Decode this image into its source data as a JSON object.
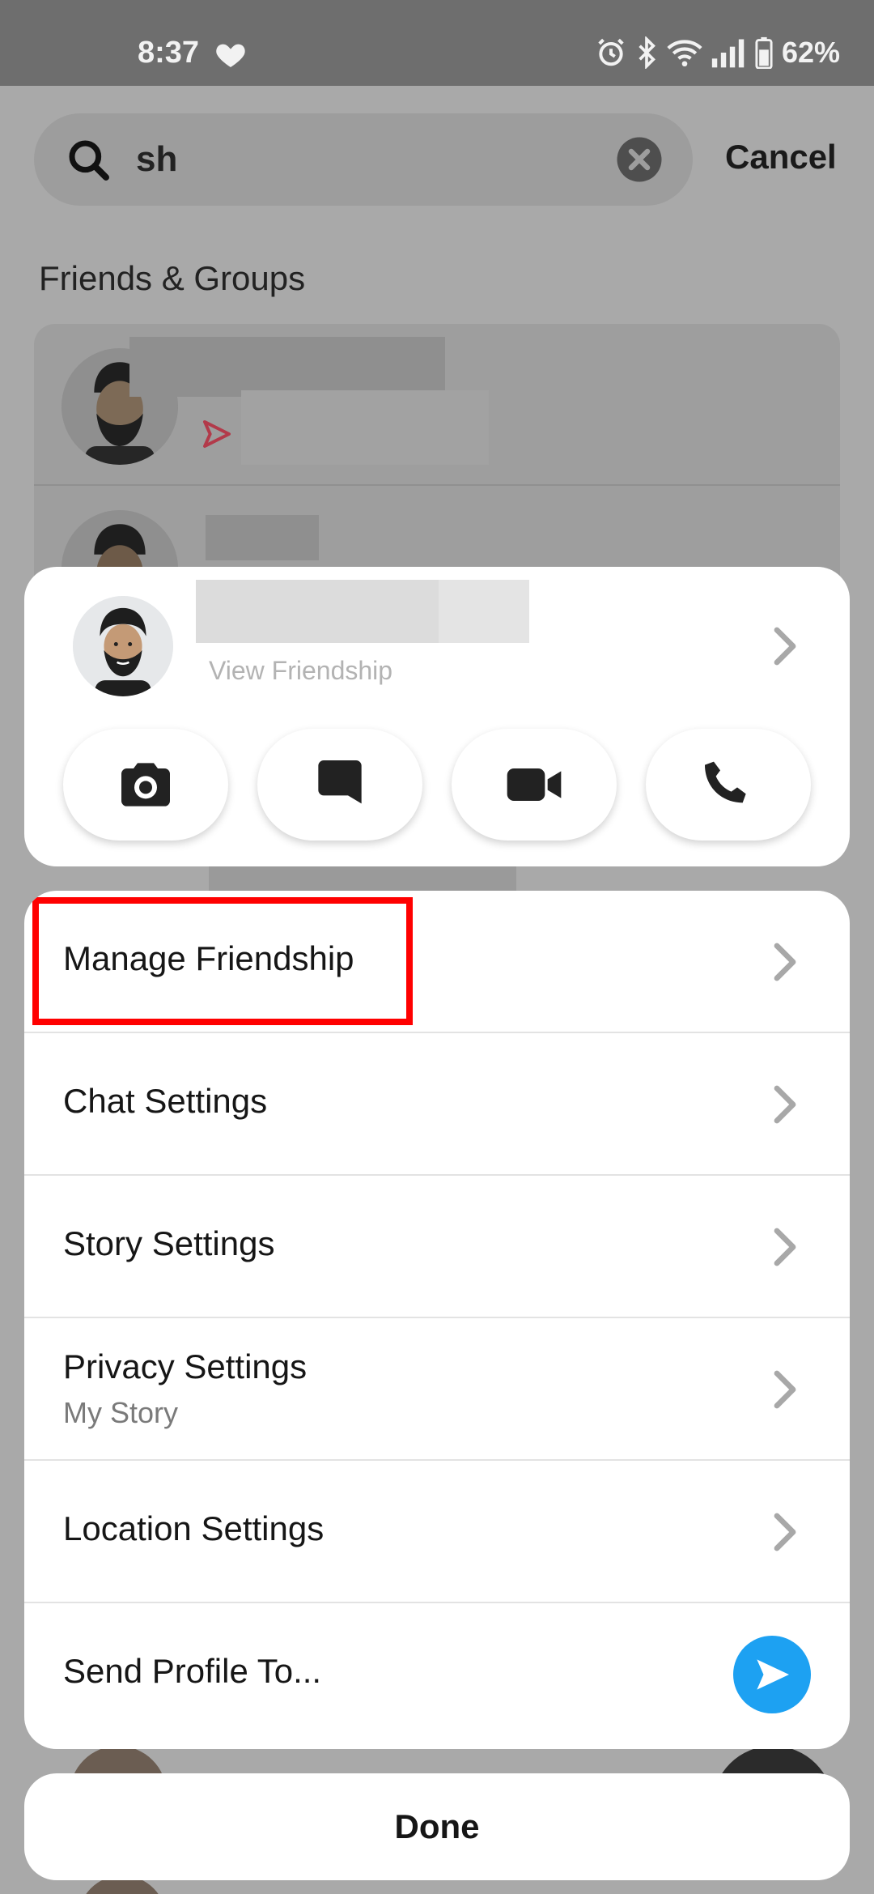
{
  "status_bar": {
    "time": "8:37",
    "battery": "62%",
    "icons": [
      "heart-icon",
      "alarm-icon",
      "bluetooth-icon",
      "wifi-icon",
      "signal-icon",
      "battery-icon"
    ]
  },
  "search": {
    "query": "sh",
    "cancel_label": "Cancel"
  },
  "friends_section": {
    "title": "Friends & Groups"
  },
  "friend_card": {
    "view_label": "View Friendship",
    "actions": [
      "camera-icon",
      "chat-icon",
      "video-call-icon",
      "phone-icon"
    ]
  },
  "menu": {
    "items": [
      {
        "label": "Manage Friendship"
      },
      {
        "label": "Chat Settings"
      },
      {
        "label": "Story Settings"
      },
      {
        "label": "Privacy Settings",
        "sub": "My Story"
      },
      {
        "label": "Location Settings"
      },
      {
        "label": "Send Profile To..."
      }
    ]
  },
  "done_label": "Done",
  "colors": {
    "highlight": "#ff0000",
    "send_button": "#1da1f2",
    "snap_red": "#e8304a"
  }
}
